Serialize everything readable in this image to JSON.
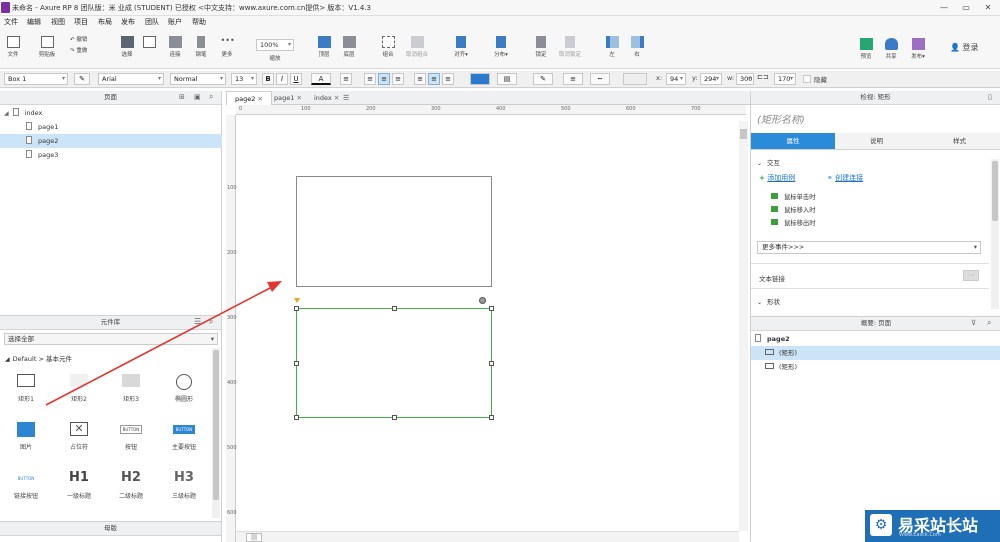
{
  "window": {
    "title": "未命名 - Axure RP 8 团队版：米 业成 (STUDENT) 已授权 <中文支持：www.axure.com.cn提供> 版本：V1.4.3",
    "controls": {
      "minimize": "—",
      "maximize": "▭",
      "close": "✕"
    }
  },
  "menu": [
    "文件",
    "编辑",
    "视图",
    "项目",
    "布局",
    "发布",
    "团队",
    "账户",
    "帮助"
  ],
  "toolbar": {
    "file_label": "文件",
    "clipboard_label": "剪贴板",
    "undo_label": "撤销",
    "redo_label": "重做",
    "select_label": "选择",
    "connect_label": "连接",
    "pen_label": "钢笔",
    "more_label": "更多",
    "zoom_value": "100%",
    "zoom_label": "缩放",
    "top_label": "顶层",
    "bottom_label": "底层",
    "group_label": "组合",
    "ungroup_label": "取消组合",
    "align_label": "对齐",
    "distribute_label": "分布",
    "lock_label": "锁定",
    "unlock_label": "取消锁定",
    "left_label": "左",
    "right_label": "右",
    "preview_label": "预览",
    "share_label": "共享",
    "publish_label": "发布",
    "login_label": "登录"
  },
  "format": {
    "style_name": "Box 1",
    "font_family": "Arial",
    "font_weight": "Normal",
    "font_size": "13",
    "bold": "B",
    "italic": "I",
    "underline": "U",
    "font_color": "A",
    "x_label": "x:",
    "x_value": "94",
    "y_label": "y:",
    "y_value": "294",
    "w_label": "w:",
    "w_value": "300",
    "h_value": "170",
    "hidden_label": "隐藏"
  },
  "pages_panel": {
    "title": "页面",
    "root": "index",
    "items": [
      "page1",
      "page2",
      "page3"
    ],
    "selected": "page2"
  },
  "library_panel": {
    "title": "元件库",
    "filter_value": "选择全部",
    "group_title": "Default > 基本元件",
    "widgets": [
      {
        "label": "矩形1",
        "icon": "rectangle-outline-icon"
      },
      {
        "label": "矩形2",
        "icon": "rectangle-light-icon"
      },
      {
        "label": "矩形3",
        "icon": "rectangle-gray-icon"
      },
      {
        "label": "椭圆形",
        "icon": "ellipse-icon"
      },
      {
        "label": "图片",
        "icon": "image-icon"
      },
      {
        "label": "占位符",
        "icon": "placeholder-icon"
      },
      {
        "label": "按钮",
        "icon": "button-icon",
        "text": "BUTTON"
      },
      {
        "label": "主要按钮",
        "icon": "primary-button-icon",
        "text": "BUTTON"
      },
      {
        "label": "链接按钮",
        "icon": "link-button-icon",
        "text": "BUTTON"
      },
      {
        "label": "一级标题",
        "icon": "h1-icon",
        "text": "H1"
      },
      {
        "label": "二级标题",
        "icon": "h2-icon",
        "text": "H2"
      },
      {
        "label": "三级标题",
        "icon": "h3-icon",
        "text": "H3"
      }
    ]
  },
  "masters_panel": {
    "title": "母版"
  },
  "editor": {
    "tabs": [
      "page2",
      "page1",
      "index"
    ],
    "active_tab": "page2",
    "ruler_h": [
      "0",
      "100",
      "200",
      "300",
      "400",
      "500",
      "600",
      "700"
    ],
    "ruler_v": [
      "100",
      "200",
      "300",
      "400",
      "500",
      "600"
    ],
    "bottom_tab": "|||"
  },
  "inspector": {
    "title": "检视: 矩形",
    "shape_name_placeholder": "(矩形名称)",
    "tabs": [
      "属性",
      "说明",
      "样式"
    ],
    "active_tab": "属性",
    "interaction_title": "交互",
    "add_case": "添加用例",
    "create_link": "创建连接",
    "events": [
      "鼠标单击时",
      "鼠标移入时",
      "鼠标移出时"
    ],
    "more_events": "更多事件>>>",
    "text_link": "文本链接",
    "shape_section": "形状"
  },
  "outline": {
    "title": "概要: 页面",
    "page": "page2",
    "items": [
      "(矩形)",
      "(矩形)"
    ]
  },
  "watermark": {
    "text": "易采站长站",
    "sub": "Www.Easck.Com"
  },
  "colors": {
    "accent": "#2a8bd8",
    "selection_green": "#3fb24a",
    "arrow_red": "#e2362e"
  }
}
